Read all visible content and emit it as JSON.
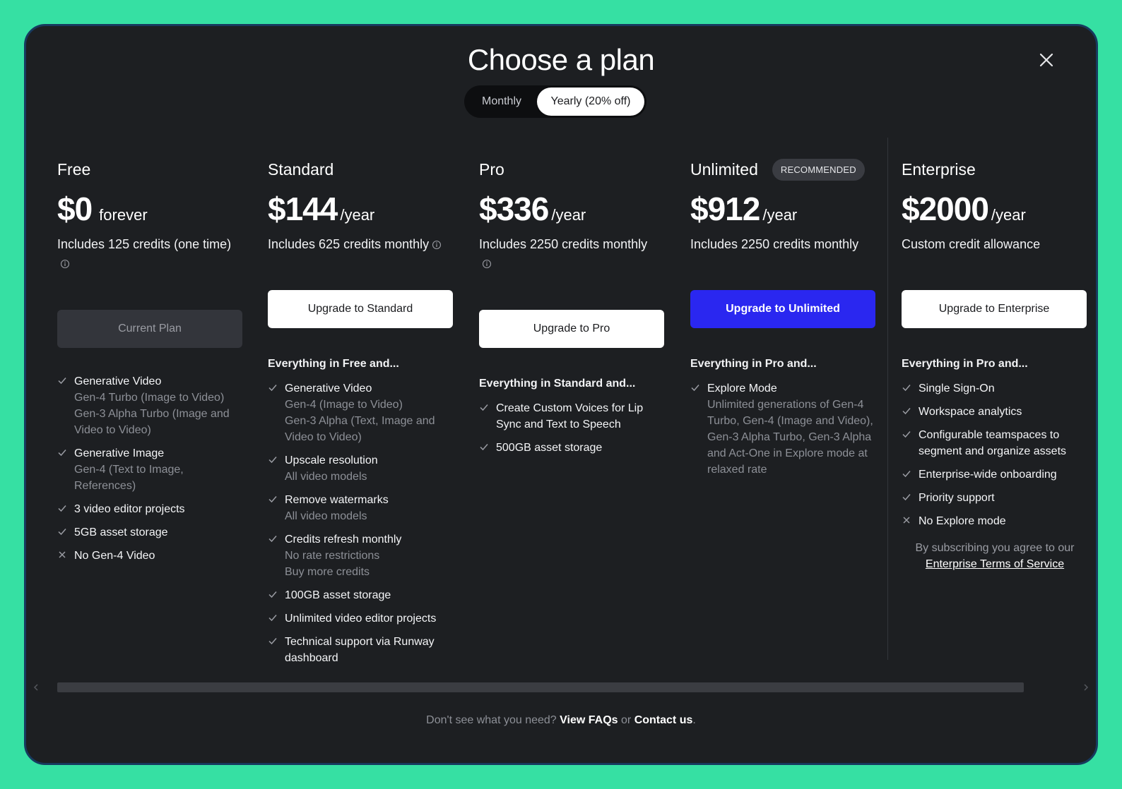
{
  "title": "Choose a plan",
  "billing_toggle": {
    "monthly": "Monthly",
    "yearly": "Yearly (20% off)",
    "selected": "yearly"
  },
  "plans": [
    {
      "name": "Free",
      "badge": "",
      "price": "$0",
      "period": "forever",
      "credits": "Includes 125 credits (one time)",
      "cta": "Current Plan",
      "includes": "",
      "features": [
        {
          "mark": "check",
          "title": "Generative Video",
          "details": [
            "Gen-4 Turbo (Image to Video)",
            "Gen-3 Alpha Turbo (Image and Video to Video)"
          ]
        },
        {
          "mark": "check",
          "title": "Generative Image",
          "details": [
            "Gen-4 (Text to Image, References)"
          ]
        },
        {
          "mark": "check",
          "title": "3 video editor projects",
          "details": []
        },
        {
          "mark": "check",
          "title": "5GB asset storage",
          "details": []
        },
        {
          "mark": "cross",
          "title": "No Gen-4 Video",
          "details": []
        }
      ]
    },
    {
      "name": "Standard",
      "badge": "",
      "price": "$144",
      "period": "/year",
      "credits": "Includes 625 credits monthly",
      "cta": "Upgrade to Standard",
      "includes": "Everything in Free and...",
      "features": [
        {
          "mark": "check",
          "title": "Generative Video",
          "details": [
            "Gen-4 (Image to Video)",
            "Gen-3 Alpha (Text, Image and Video to Video)"
          ]
        },
        {
          "mark": "check",
          "title": "Upscale resolution",
          "details": [
            "All video models"
          ]
        },
        {
          "mark": "check",
          "title": "Remove watermarks",
          "details": [
            "All video models"
          ]
        },
        {
          "mark": "check",
          "title": "Credits refresh monthly",
          "details": [
            "No rate restrictions",
            "Buy more credits"
          ]
        },
        {
          "mark": "check",
          "title": "100GB asset storage",
          "details": []
        },
        {
          "mark": "check",
          "title": "Unlimited video editor projects",
          "details": []
        },
        {
          "mark": "check",
          "title": "Technical support via Runway dashboard",
          "details": []
        }
      ]
    },
    {
      "name": "Pro",
      "badge": "",
      "price": "$336",
      "period": "/year",
      "credits": "Includes 2250 credits monthly",
      "cta": "Upgrade to Pro",
      "includes": "Everything in Standard and...",
      "features": [
        {
          "mark": "check",
          "title": "Create Custom Voices for Lip Sync and Text to Speech",
          "details": []
        },
        {
          "mark": "check",
          "title": "500GB asset storage",
          "details": []
        }
      ]
    },
    {
      "name": "Unlimited",
      "badge": "RECOMMENDED",
      "price": "$912",
      "period": "/year",
      "credits": "Includes 2250 credits monthly",
      "cta": "Upgrade to Unlimited",
      "includes": "Everything in Pro and...",
      "features": [
        {
          "mark": "check",
          "title": "Explore Mode",
          "details": [
            "Unlimited generations of Gen-4 Turbo, Gen-4 (Image and Video), Gen-3 Alpha Turbo, Gen-3 Alpha and Act-One in Explore mode at relaxed rate"
          ]
        }
      ]
    },
    {
      "name": "Enterprise",
      "badge": "",
      "price": "$2000",
      "period": "/year",
      "credits": "Custom credit allowance",
      "cta": "Upgrade to Enterprise",
      "includes": "Everything in Pro and...",
      "features": [
        {
          "mark": "check",
          "title": "Single Sign-On",
          "details": []
        },
        {
          "mark": "check",
          "title": "Workspace analytics",
          "details": []
        },
        {
          "mark": "check",
          "title": "Configurable teamspaces to segment and organize assets",
          "details": []
        },
        {
          "mark": "check",
          "title": "Enterprise-wide onboarding",
          "details": []
        },
        {
          "mark": "check",
          "title": "Priority support",
          "details": []
        },
        {
          "mark": "cross",
          "title": "No Explore mode",
          "details": []
        }
      ]
    }
  ],
  "legal": {
    "prefix": "By subscribing you agree to our",
    "link": "Enterprise Terms of Service"
  },
  "footer": {
    "prefix": "Don't see what you need?",
    "faq": "View FAQs",
    "or": "or",
    "contact": "Contact us",
    "suffix": "."
  },
  "colors": {
    "background": "#36e0a3",
    "modal": "#1d1f22",
    "primary_button": "#2a27f0"
  },
  "icons": {
    "close": "close-icon",
    "check": "check-icon",
    "cross": "cross-icon",
    "info": "info-icon"
  }
}
